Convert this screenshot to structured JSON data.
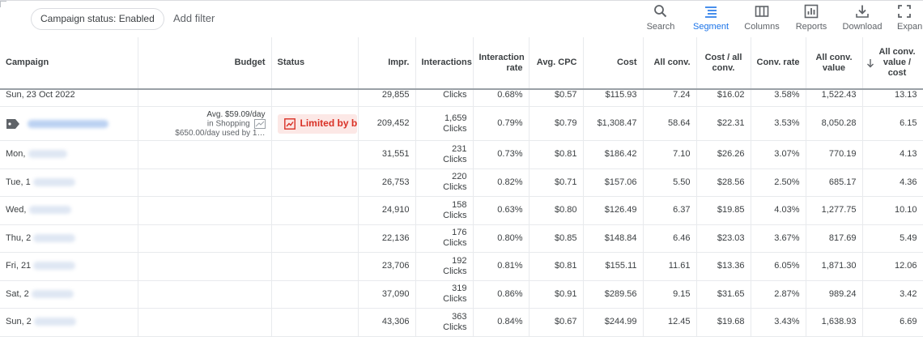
{
  "toolbar": {
    "filter_chip": "Campaign status: Enabled",
    "add_filter": "Add filter",
    "tools": [
      {
        "label": "Search",
        "icon": "search-icon"
      },
      {
        "label": "Segment",
        "icon": "segment-icon"
      },
      {
        "label": "Columns",
        "icon": "columns-icon"
      },
      {
        "label": "Reports",
        "icon": "reports-icon"
      },
      {
        "label": "Download",
        "icon": "download-icon"
      },
      {
        "label": "Expan",
        "icon": "expand-icon"
      }
    ],
    "active_color": "#1a73e8"
  },
  "table": {
    "headers": [
      "Campaign",
      "Budget",
      "Status",
      "Impr.",
      "Interactions",
      "Interaction rate",
      "Avg. CPC",
      "Cost",
      "All conv.",
      "Cost / all conv.",
      "Conv. rate",
      "All conv. value",
      "All conv. value / cost"
    ],
    "sort_icon": "arrow-down-icon",
    "partial_row": {
      "campaign": "Sun, 23 Oct 2022",
      "impr": "29,855",
      "interactions": "Clicks",
      "interaction_rate": "0.68%",
      "avg_cpc": "$0.57",
      "cost": "$115.93",
      "all_conv": "7.24",
      "cost_per_conv": "$16.02",
      "conv_rate": "3.58%",
      "conv_value": "1,522.43",
      "value_per_cost": "13.13"
    },
    "total_row": {
      "budget_line1": "Avg. $59.09/day",
      "budget_line2": "in Shopping",
      "budget_line3": "$650.00/day used by 1…",
      "status": "Limited by b",
      "impr": "209,452",
      "interactions_count": "1,659",
      "interactions_type": "Clicks",
      "interaction_rate": "0.79%",
      "avg_cpc": "$0.79",
      "cost": "$1,308.47",
      "all_conv": "58.64",
      "cost_per_conv": "$22.31",
      "conv_rate": "3.53%",
      "conv_value": "8,050.28",
      "value_per_cost": "6.15",
      "status_color": "#d93025"
    },
    "rows": [
      {
        "day": "Mon,",
        "impr": "31,551",
        "clicks": "231",
        "type": "Clicks",
        "rate": "0.73%",
        "cpc": "$0.81",
        "cost": "$186.42",
        "conv": "7.10",
        "cpconv": "$26.26",
        "convrate": "3.07%",
        "value": "770.19",
        "vpc": "4.13"
      },
      {
        "day": "Tue, 1",
        "impr": "26,753",
        "clicks": "220",
        "type": "Clicks",
        "rate": "0.82%",
        "cpc": "$0.71",
        "cost": "$157.06",
        "conv": "5.50",
        "cpconv": "$28.56",
        "convrate": "2.50%",
        "value": "685.17",
        "vpc": "4.36"
      },
      {
        "day": "Wed,",
        "impr": "24,910",
        "clicks": "158",
        "type": "Clicks",
        "rate": "0.63%",
        "cpc": "$0.80",
        "cost": "$126.49",
        "conv": "6.37",
        "cpconv": "$19.85",
        "convrate": "4.03%",
        "value": "1,277.75",
        "vpc": "10.10"
      },
      {
        "day": "Thu, 2",
        "impr": "22,136",
        "clicks": "176",
        "type": "Clicks",
        "rate": "0.80%",
        "cpc": "$0.85",
        "cost": "$148.84",
        "conv": "6.46",
        "cpconv": "$23.03",
        "convrate": "3.67%",
        "value": "817.69",
        "vpc": "5.49"
      },
      {
        "day": "Fri, 21",
        "impr": "23,706",
        "clicks": "192",
        "type": "Clicks",
        "rate": "0.81%",
        "cpc": "$0.81",
        "cost": "$155.11",
        "conv": "11.61",
        "cpconv": "$13.36",
        "convrate": "6.05%",
        "value": "1,871.30",
        "vpc": "12.06"
      },
      {
        "day": "Sat, 2",
        "impr": "37,090",
        "clicks": "319",
        "type": "Clicks",
        "rate": "0.86%",
        "cpc": "$0.91",
        "cost": "$289.56",
        "conv": "9.15",
        "cpconv": "$31.65",
        "convrate": "2.87%",
        "value": "989.24",
        "vpc": "3.42"
      },
      {
        "day": "Sun, 2",
        "impr": "43,306",
        "clicks": "363",
        "type": "Clicks",
        "rate": "0.84%",
        "cpc": "$0.67",
        "cost": "$244.99",
        "conv": "12.45",
        "cpconv": "$19.68",
        "convrate": "3.43%",
        "value": "1,638.93",
        "vpc": "6.69"
      }
    ]
  }
}
